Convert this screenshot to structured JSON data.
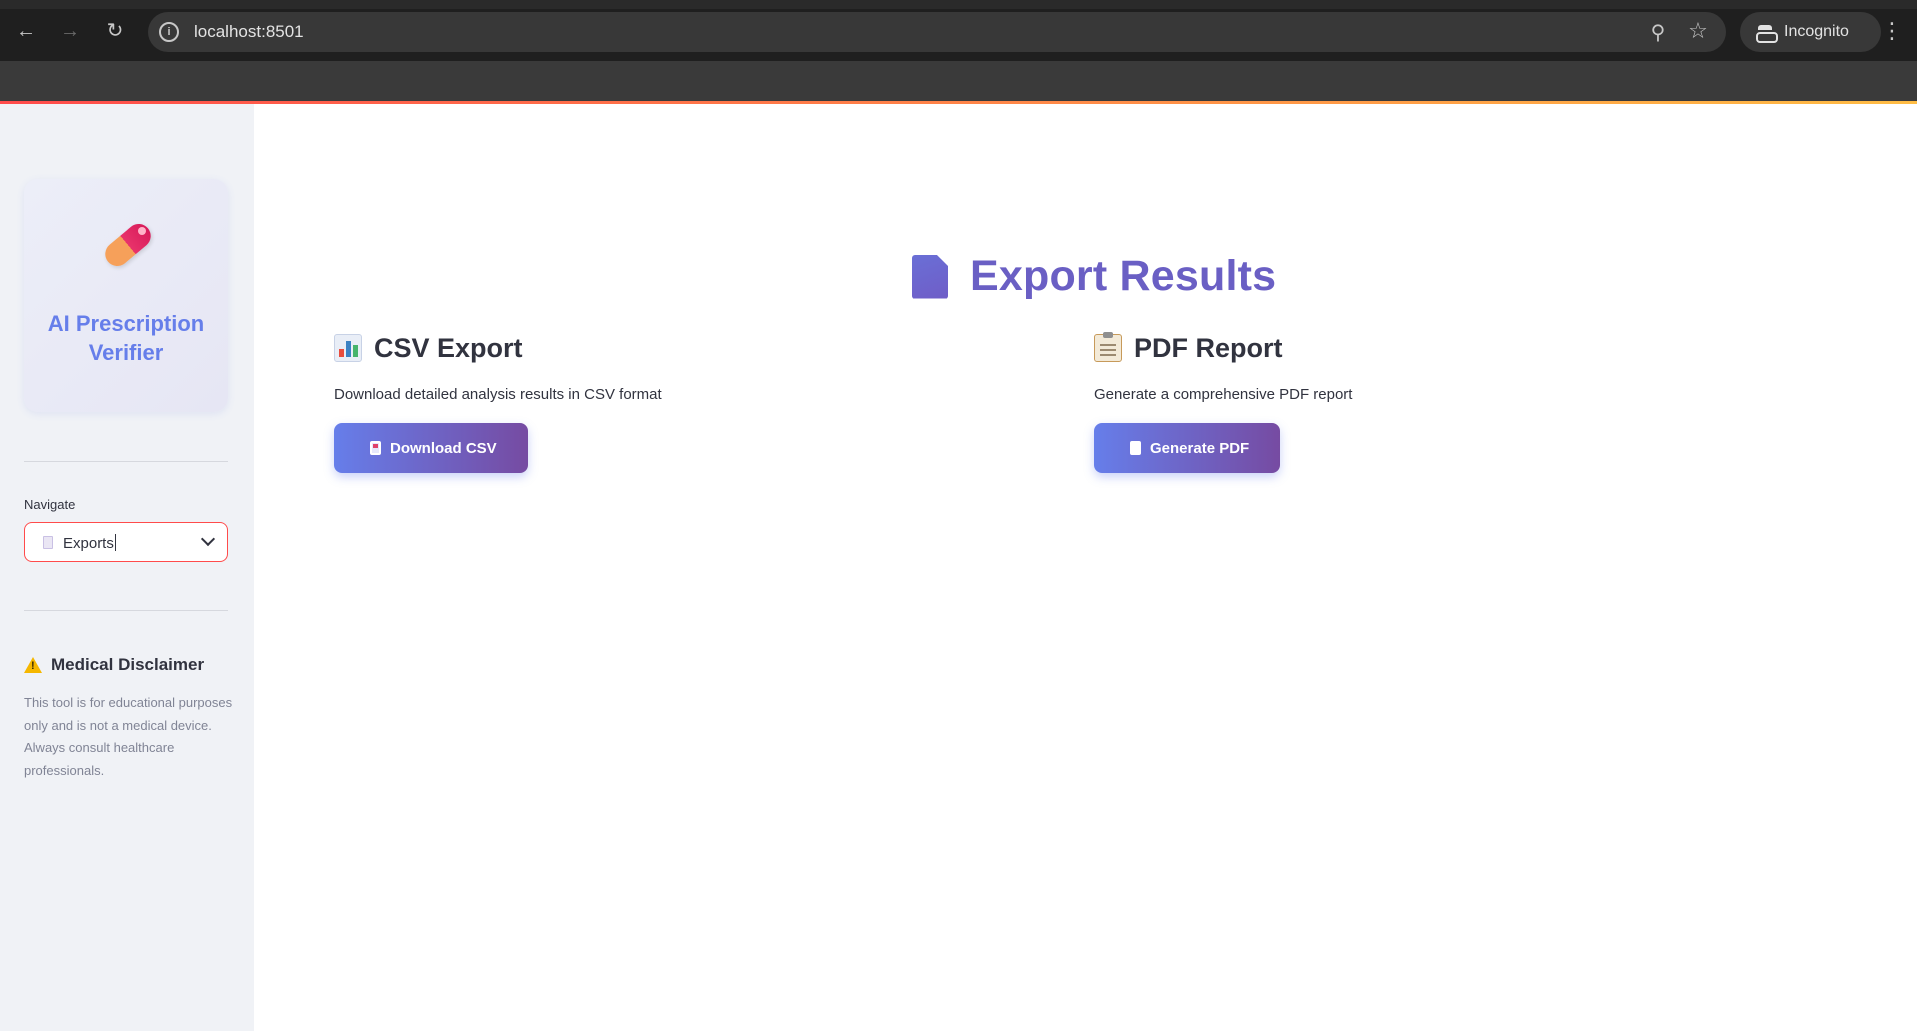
{
  "browser": {
    "url": "localhost:8501",
    "incognito_label": "Incognito",
    "icons": [
      "back-arrow-icon",
      "forward-arrow-icon",
      "reload-icon",
      "info-icon",
      "zoom-icon",
      "star-icon",
      "incognito-icon",
      "more-vert-icon"
    ]
  },
  "sidebar": {
    "logo_title": "AI Prescription Verifier",
    "logo_icon": "pill-icon",
    "nav_label": "Navigate",
    "nav_selected": "Exports",
    "disclaimer_title": "Medical Disclaimer",
    "disclaimer_text": "This tool is for educational purposes only and is not a medical device. Always consult healthcare professionals."
  },
  "main": {
    "title": "Export Results",
    "csv": {
      "heading": "CSV Export",
      "description": "Download detailed analysis results in CSV format",
      "button_label": "Download CSV"
    },
    "pdf": {
      "heading": "PDF Report",
      "description": "Generate a comprehensive PDF report",
      "button_label": "Generate PDF"
    }
  },
  "colors": {
    "accent": "#667eea",
    "accent_end": "#764ba2",
    "title": "#6a5fc4",
    "sidebar_bg": "#f0f2f6",
    "focus_border": "#ff4b4b"
  }
}
